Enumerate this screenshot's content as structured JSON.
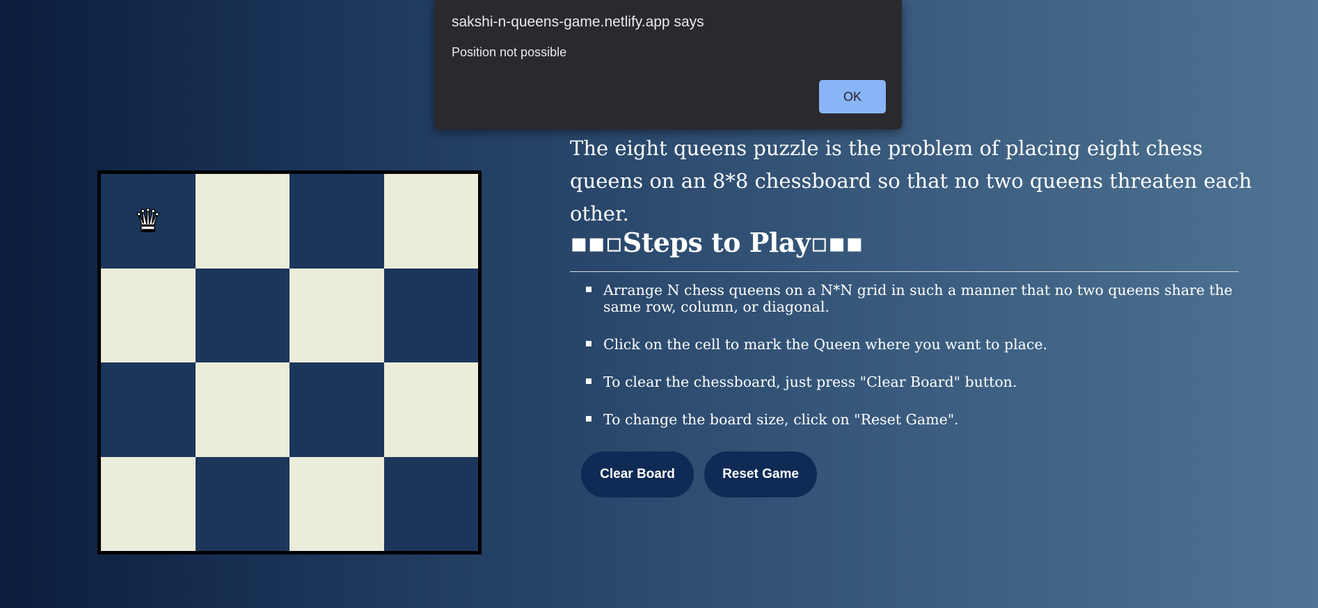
{
  "board": {
    "size": 4,
    "queen_symbol": "♛",
    "queens": [
      [
        0,
        0
      ]
    ],
    "dark_color": "#1c365b",
    "light_color": "#ececdb"
  },
  "intro": "The eight queens puzzle is the problem of placing eight chess queens on an 8*8 chessboard so that no two queens threaten each other.",
  "steps_heading": "▪▪▫Steps to Play▫▪▪",
  "steps": [
    "Arrange N chess queens on a N*N grid in such a manner that no two queens share the same row, column, or diagonal.",
    "Click on the cell to mark the Queen where you want to place.",
    "To clear the chessboard, just press \"Clear Board\" button.",
    "To change the board size, click on \"Reset Game\"."
  ],
  "buttons": {
    "clear": "Clear Board",
    "reset": "Reset Game"
  },
  "dialog": {
    "title": "sakshi-n-queens-game.netlify.app says",
    "message": "Position not possible",
    "ok": "OK"
  },
  "colors": {
    "button_bg": "#0e2a55",
    "dialog_bg": "#292a2d",
    "ok_bg": "#8ab4f8"
  }
}
